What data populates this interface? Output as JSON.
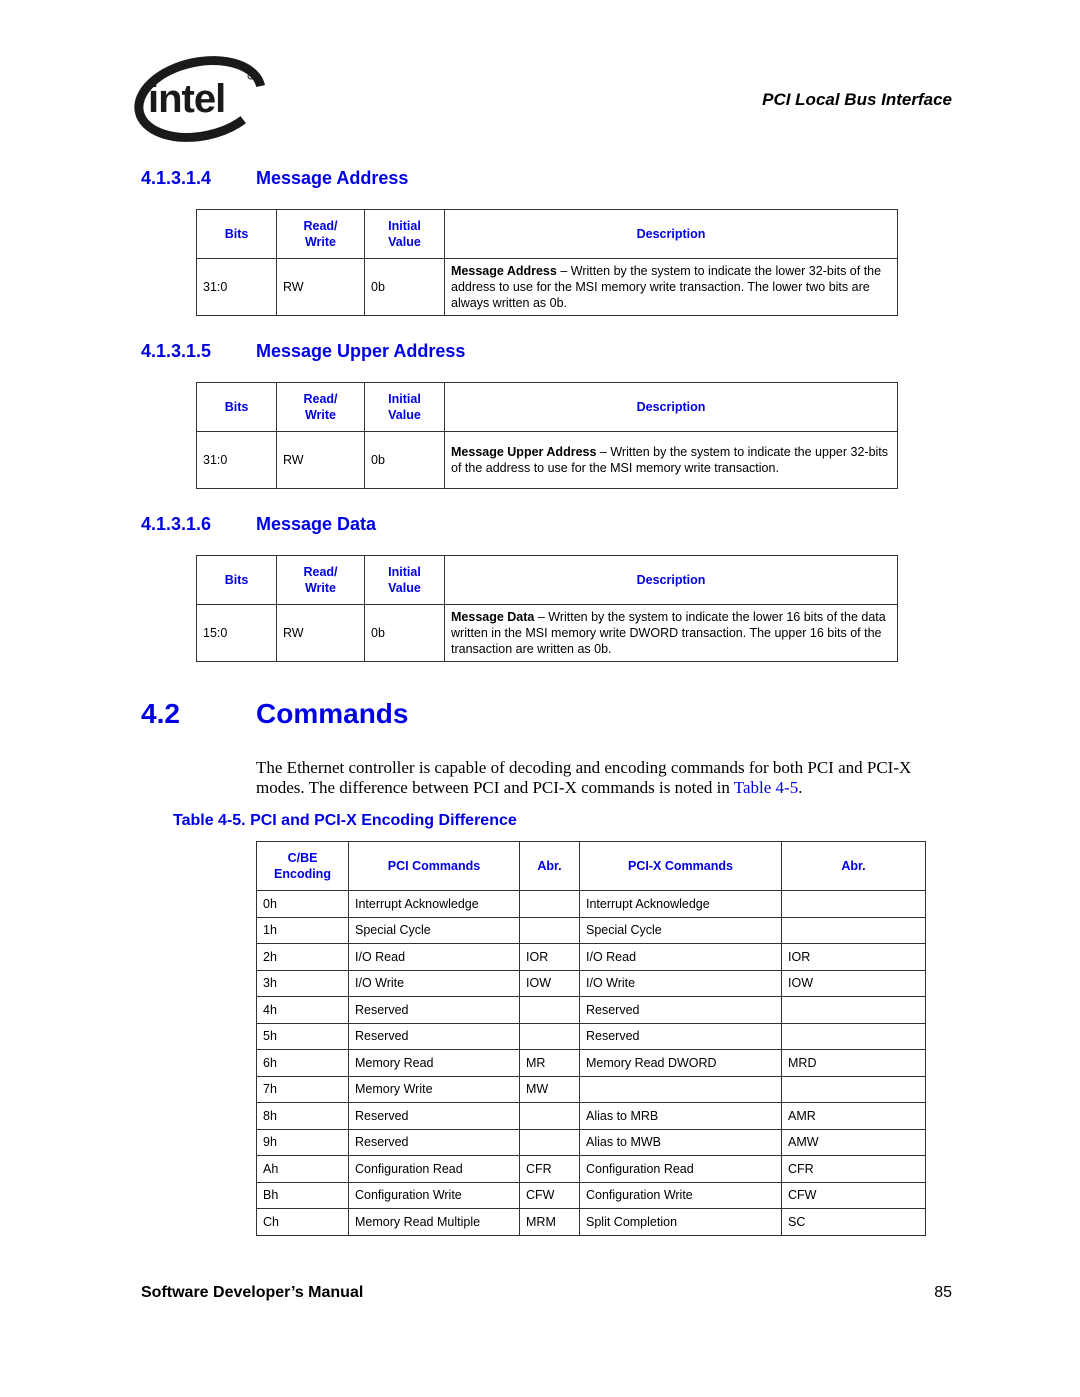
{
  "header": {
    "logo_text": "intel",
    "running_title": "PCI Local Bus Interface"
  },
  "sections": [
    {
      "number": "4.1.3.1.4",
      "title": "Message Address",
      "table": {
        "headers": [
          "Bits",
          "Read/\nWrite",
          "Initial\nValue",
          "Description"
        ],
        "rows": [
          {
            "bits": "31:0",
            "rw": "RW",
            "initial": "0b",
            "desc_bold": "Message Address",
            "desc_text": " – Written by the system to indicate the lower 32-bits of the address to use for the MSI memory write transaction. The lower two bits are always written as 0b."
          }
        ]
      }
    },
    {
      "number": "4.1.3.1.5",
      "title": "Message Upper Address",
      "table": {
        "headers": [
          "Bits",
          "Read/\nWrite",
          "Initial\nValue",
          "Description"
        ],
        "rows": [
          {
            "bits": "31:0",
            "rw": "RW",
            "initial": "0b",
            "desc_bold": "Message Upper Address",
            "desc_text": " – Written by the system to indicate the upper 32-bits of the address to use for the MSI memory write transaction."
          }
        ]
      }
    },
    {
      "number": "4.1.3.1.6",
      "title": "Message Data",
      "table": {
        "headers": [
          "Bits",
          "Read/\nWrite",
          "Initial\nValue",
          "Description"
        ],
        "rows": [
          {
            "bits": "15:0",
            "rw": "RW",
            "initial": "0b",
            "desc_bold": "Message Data",
            "desc_text": " – Written by the system to indicate the lower 16 bits of the data written in the MSI memory write DWORD transaction. The upper 16 bits of the transaction are written as 0b."
          }
        ]
      }
    }
  ],
  "commands": {
    "number": "4.2",
    "title": "Commands",
    "paragraph_text": "The Ethernet controller is capable of decoding and encoding commands for both PCI and PCI-X modes. The difference between PCI and PCI-X commands is noted in ",
    "paragraph_link": "Table 4-5",
    "paragraph_end": ".",
    "table_caption": "Table 4-5. PCI and PCI-X Encoding Difference",
    "table": {
      "headers": [
        "C/BE\nEncoding",
        "PCI Commands",
        "Abr.",
        "PCI-X Commands",
        "Abr."
      ],
      "rows": [
        [
          "0h",
          "Interrupt Acknowledge",
          "",
          "Interrupt Acknowledge",
          ""
        ],
        [
          "1h",
          "Special Cycle",
          "",
          "Special Cycle",
          ""
        ],
        [
          "2h",
          "I/O Read",
          "IOR",
          "I/O Read",
          "IOR"
        ],
        [
          "3h",
          "I/O Write",
          "IOW",
          "I/O Write",
          "IOW"
        ],
        [
          "4h",
          "Reserved",
          "",
          "Reserved",
          ""
        ],
        [
          "5h",
          "Reserved",
          "",
          "Reserved",
          ""
        ],
        [
          "6h",
          "Memory Read",
          "MR",
          "Memory Read DWORD",
          "MRD"
        ],
        [
          "7h",
          "Memory Write",
          "MW",
          "",
          ""
        ],
        [
          "8h",
          "Reserved",
          "",
          "Alias to MRB",
          "AMR"
        ],
        [
          "9h",
          "Reserved",
          "",
          "Alias to MWB",
          "AMW"
        ],
        [
          "Ah",
          "Configuration Read",
          "CFR",
          "Configuration Read",
          "CFR"
        ],
        [
          "Bh",
          "Configuration Write",
          "CFW",
          "Configuration Write",
          "CFW"
        ],
        [
          "Ch",
          "Memory Read Multiple",
          "MRM",
          "Split Completion",
          "SC"
        ]
      ]
    }
  },
  "footer": {
    "title": "Software Developer’s Manual",
    "page_number": "85"
  },
  "colors": {
    "heading_blue": "#0000e6",
    "text": "#000000",
    "border": "#333333"
  }
}
